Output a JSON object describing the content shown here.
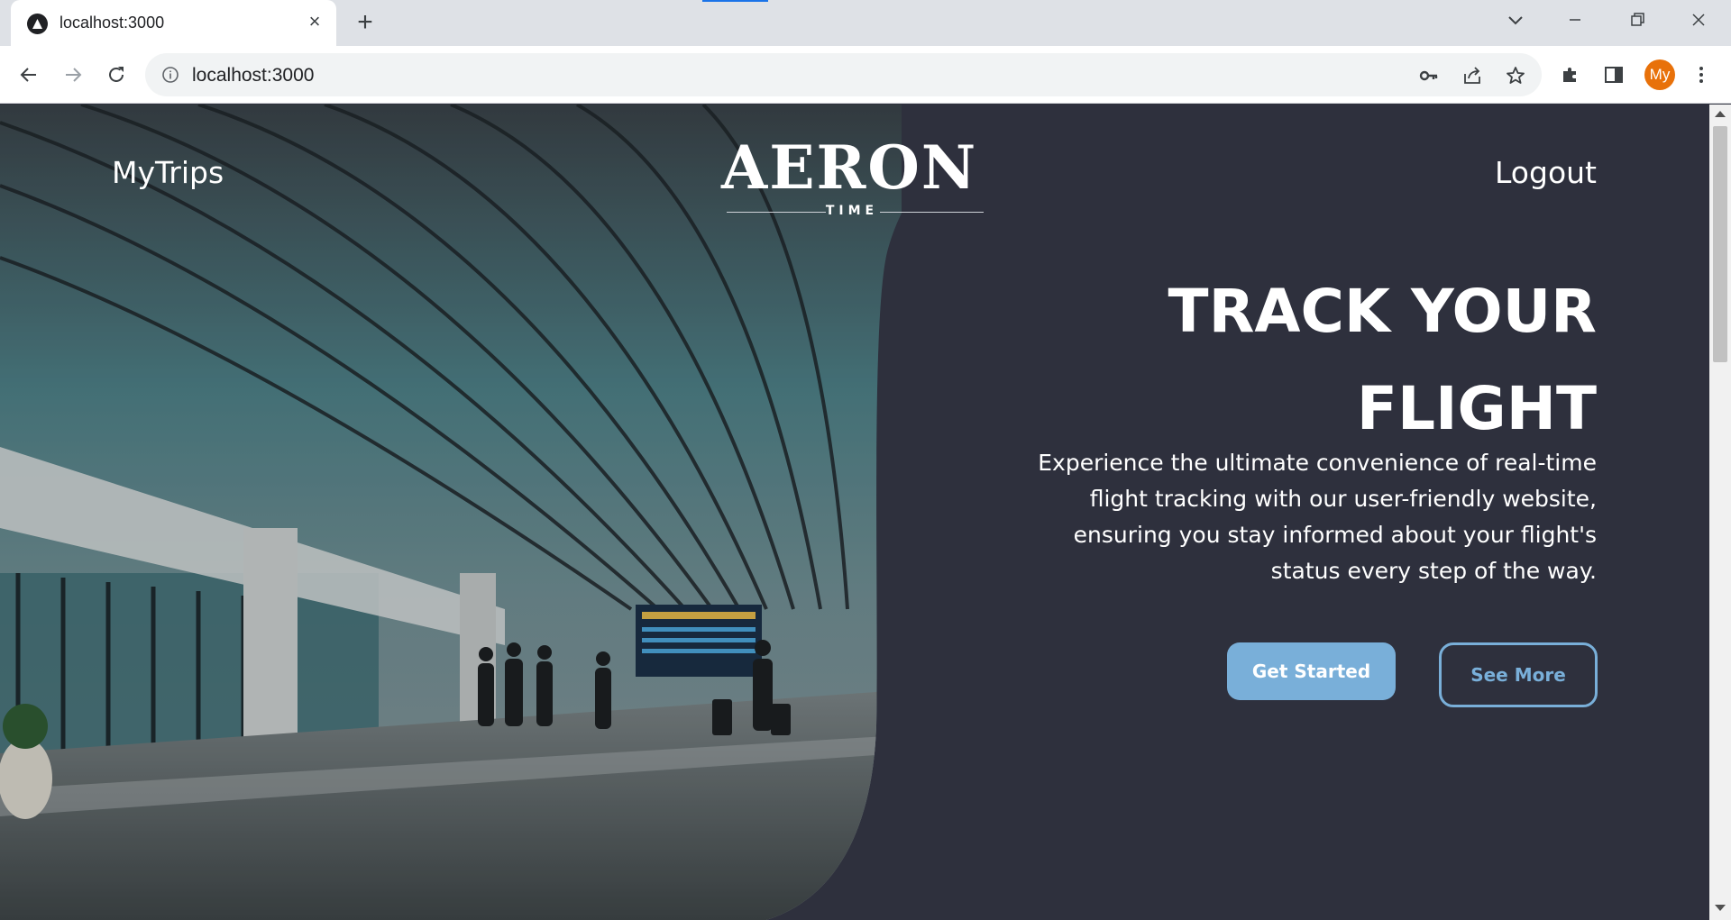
{
  "browser": {
    "tab_title": "localhost:3000",
    "url": "localhost:3000",
    "profile_initials": "My"
  },
  "site": {
    "nav_left": "MyTrips",
    "nav_right": "Logout",
    "logo_text": "AERON",
    "logo_sub": "TIME",
    "headline_line1": "TRACK YOUR",
    "headline_line2": "FLIGHT",
    "description": "Experience the ultimate convenience of real-time flight tracking with our user-friendly website, ensuring you stay informed about your flight's status every step of the way.",
    "primary_button": "Get Started",
    "secondary_button": "See More"
  },
  "colors": {
    "panel": "#2e303d",
    "accent": "#79afd9",
    "profile": "#e8710a"
  },
  "icons": [
    "back-icon",
    "forward-icon",
    "reload-icon",
    "info-icon",
    "key-icon",
    "share-icon",
    "star-icon",
    "extensions-icon",
    "side-panel-icon",
    "menu-icon"
  ]
}
